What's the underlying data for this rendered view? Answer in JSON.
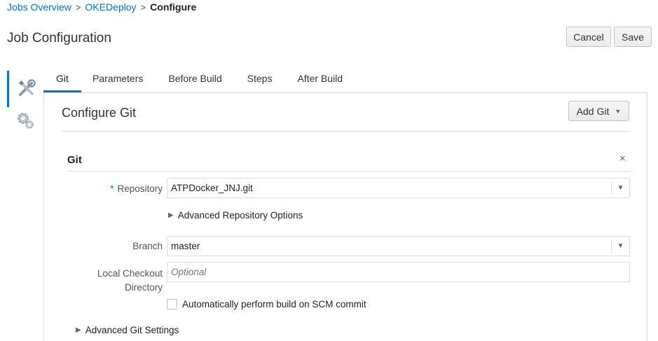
{
  "breadcrumb": {
    "items": [
      "Jobs Overview",
      "OKEDeploy"
    ],
    "current": "Configure",
    "separator": ">"
  },
  "page": {
    "title": "Job Configuration"
  },
  "actions": {
    "cancel_label": "Cancel",
    "save_label": "Save"
  },
  "side_rail": {
    "items": [
      {
        "icon": "tools-icon",
        "active": true
      },
      {
        "icon": "gears-icon",
        "active": false
      }
    ]
  },
  "tabs": [
    "Git",
    "Parameters",
    "Before Build",
    "Steps",
    "After Build"
  ],
  "active_tab": "Git",
  "section": {
    "title": "Configure Git",
    "add_button_label": "Add Git"
  },
  "git": {
    "heading": "Git",
    "close_glyph": "×",
    "repository": {
      "required_marker": "*",
      "label": "Repository",
      "value": "ATPDocker_JNJ.git"
    },
    "advanced_repository_options": "Advanced Repository Options",
    "branch": {
      "label": "Branch",
      "value": "master"
    },
    "local_checkout": {
      "label_line1": "Local Checkout",
      "label_line2": "Directory",
      "placeholder": "Optional",
      "value": ""
    },
    "auto_build": {
      "label": "Automatically perform build on SCM commit",
      "checked": false
    }
  },
  "advanced_git_settings": "Advanced Git Settings",
  "colors": {
    "accent": "#0572ce",
    "border": "#dcdcdc",
    "text": "#333333"
  }
}
